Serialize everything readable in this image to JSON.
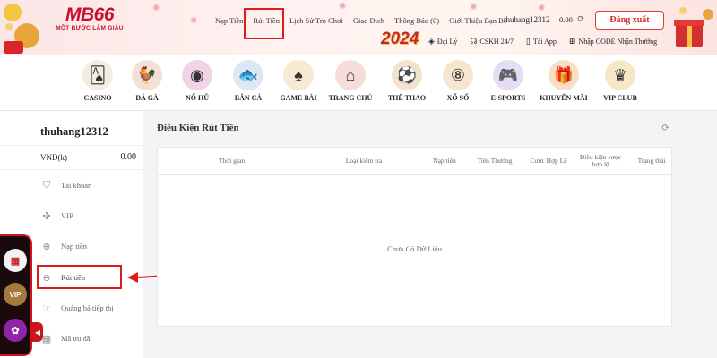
{
  "brand": {
    "name": "MB66",
    "tagline": "MỘT BƯỚC LÀM GIÀU",
    "year_badge": "2024",
    "accent": "#c8102e"
  },
  "topnav": {
    "items": [
      "Nạp Tiền",
      "Rút Tiền",
      "Lịch Sử Trò Chơi",
      "Giao Dịch",
      "Thông Báo (0)",
      "Giới Thiệu Bạn Bè"
    ],
    "active": "Rút Tiền"
  },
  "account": {
    "username": "thuhang12312",
    "balance": "0.00",
    "logout_label": "Đăng xuất"
  },
  "subnav": {
    "items": [
      "Đại Lý",
      "CSKH 24/7",
      "Tải App",
      "Nhập CODE Nhận Thưởng"
    ]
  },
  "games": [
    {
      "label": "CASINO",
      "icon": "cards-icon"
    },
    {
      "label": "ĐÁ GÀ",
      "icon": "rooster-icon"
    },
    {
      "label": "NỔ HŨ",
      "icon": "slot-icon"
    },
    {
      "label": "BẮN CÁ",
      "icon": "fish-icon"
    },
    {
      "label": "GAME BÀI",
      "icon": "card-game-icon"
    },
    {
      "label": "TRANG CHỦ",
      "icon": "home-icon"
    },
    {
      "label": "THỂ THAO",
      "icon": "football-icon"
    },
    {
      "label": "XỔ SỐ",
      "icon": "lottery-icon"
    },
    {
      "label": "E-SPORTS",
      "icon": "gamepad-icon"
    },
    {
      "label": "KHUYẾN MÃI",
      "icon": "gift-icon"
    },
    {
      "label": "VIP CLUB",
      "icon": "vip-icon"
    }
  ],
  "sidebar": {
    "username": "thuhang12312",
    "currency": "VND(k)",
    "balance": "0.00",
    "items": [
      {
        "label": "Tài khoản",
        "icon": "user-shield-icon"
      },
      {
        "label": "VIP",
        "icon": "vip-badge-icon"
      },
      {
        "label": "Nạp tiền",
        "icon": "deposit-icon"
      },
      {
        "label": "Rút tiền",
        "icon": "withdraw-icon"
      },
      {
        "label": "Quảng bá tiếp thị",
        "icon": "promote-icon"
      },
      {
        "label": "Mã ưu đãi",
        "icon": "coupon-icon"
      }
    ],
    "active": "Rút tiền"
  },
  "float_panel": {
    "vip_label": "VIP"
  },
  "main": {
    "title": "Điều Kiện Rút Tiền",
    "columns": [
      "Thời gian",
      "Loại kiểm tra",
      "Nạp tiền",
      "Tiền Thưởng",
      "Cược Hợp Lệ",
      "Điều kiện cược hợp lệ",
      "Trạng thái"
    ],
    "empty_text": "Chưa Có Dữ Liệu"
  },
  "colors": {
    "highlight": "#e01a1a",
    "logout_border": "#e53935"
  }
}
